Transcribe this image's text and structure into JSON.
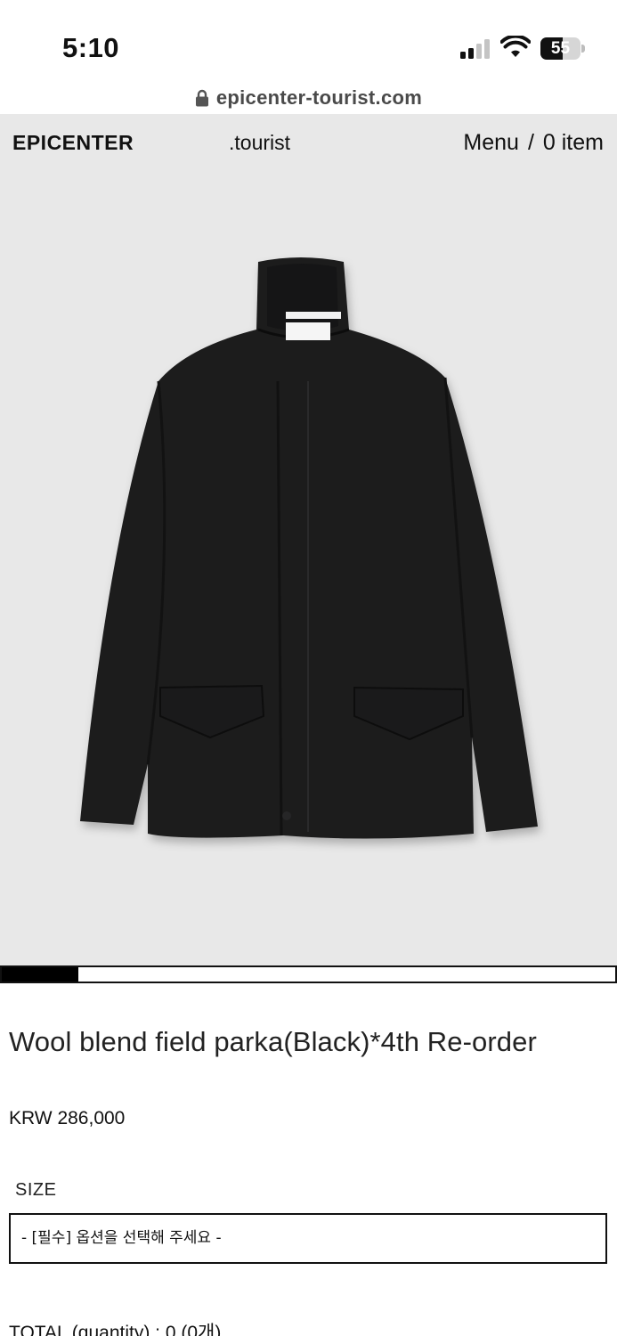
{
  "status_bar": {
    "time": "5:10",
    "battery_percent": "55",
    "battery_level": 0.55,
    "icons": [
      "cellular-signal-icon",
      "wifi-icon",
      "battery-icon"
    ]
  },
  "browser": {
    "url": "epicenter-tourist.com",
    "icon": "lock-icon"
  },
  "header": {
    "brand": "EPICENTER",
    "sub_brand": ".tourist",
    "menu_label": "Menu",
    "separator": "/",
    "cart_label": "0 item"
  },
  "gallery": {
    "image_subject": "black wool blend field parka with stand collar and two flap pockets",
    "slide_position": 0.125
  },
  "product": {
    "title": "Wool blend field parka(Black)*4th Re-order",
    "price": "KRW 286,000",
    "size_label": "SIZE",
    "size_select_value": "- [필수] 옵션을 선택해 주세요 -",
    "total_text": "TOTAL (quantity) : 0 (0개)"
  },
  "colors": {
    "hero_background": "#e8e8e8",
    "text": "#111111",
    "url_text": "#4a4a4a"
  }
}
